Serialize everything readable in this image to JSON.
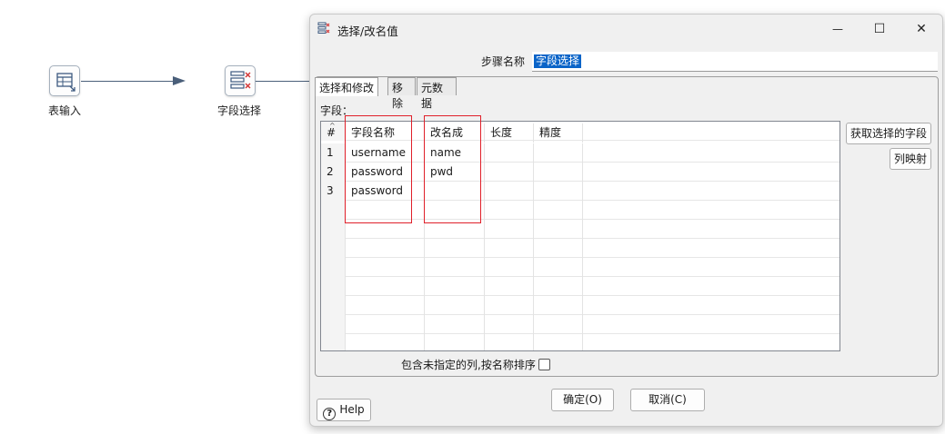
{
  "canvas": {
    "nodes": [
      {
        "label": "表输入",
        "icon": "table-input-icon"
      },
      {
        "label": "字段选择",
        "icon": "select-values-icon"
      }
    ]
  },
  "dialog": {
    "title": "选择/改名值",
    "window_controls": {
      "minimize": "—",
      "maximize": "☐",
      "close": "✕"
    },
    "step_name_label": "步骤名称",
    "step_name_value": "字段选择",
    "tabs": [
      {
        "label": "选择和修改",
        "active": true
      },
      {
        "label": "移除",
        "active": false
      },
      {
        "label": "元数据",
        "active": false
      }
    ],
    "fields_label": "字段：",
    "table": {
      "columns": [
        "#",
        "字段名称",
        "改名成",
        "长度",
        "精度"
      ],
      "rows": [
        {
          "num": "1",
          "field": "username",
          "rename": "name",
          "length": "",
          "precision": ""
        },
        {
          "num": "2",
          "field": "password",
          "rename": "pwd",
          "length": "",
          "precision": ""
        },
        {
          "num": "3",
          "field": "password",
          "rename": "",
          "length": "",
          "precision": ""
        }
      ]
    },
    "get_fields_button": "获取选择的字段",
    "column_mapping_button": "列映射",
    "include_unspecified_label": "包含未指定的列,按名称排序",
    "include_unspecified_checked": false,
    "ok_button": "确定(O)",
    "cancel_button": "取消(C)",
    "help_button": "Help",
    "highlight_color": "#e0202a",
    "selection_color": "#0a64c8"
  }
}
